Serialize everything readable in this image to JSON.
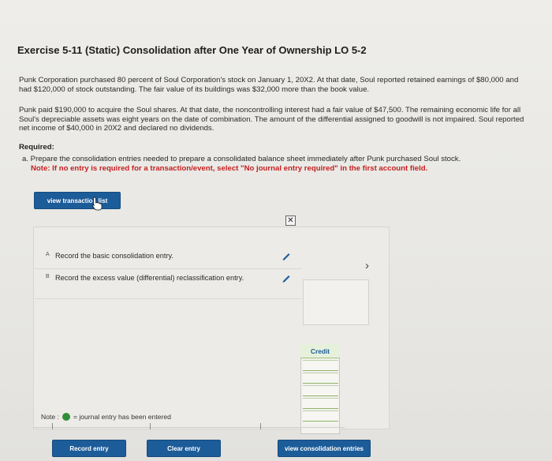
{
  "exercise": {
    "title": "Exercise 5-11 (Static) Consolidation after One Year of Ownership LO 5-2",
    "paragraph1": "Punk Corporation purchased 80 percent of Soul Corporation's stock on January 1, 20X2. At that date, Soul reported retained earnings of $80,000 and had $120,000 of stock outstanding. The fair value of its buildings was $32,000 more than the book value.",
    "paragraph2": "Punk paid $190,000 to acquire the Soul shares. At that date, the noncontrolling interest had a fair value of $47,500. The remaining economic life for all Soul's depreciable assets was eight years on the date of combination. The amount of the differential assigned to goodwill is not impaired. Soul reported net income of $40,000 in 20X2 and declared no dividends.",
    "required_label": "Required:",
    "requirement_a": "a. Prepare the consolidation entries needed to prepare a consolidated balance sheet immediately after Punk purchased Soul stock.",
    "note_red": "Note: If no entry is required for a transaction/event, select \"No journal entry required\" in the first account field."
  },
  "buttons": {
    "view_transaction_list": "view transaction list",
    "record_entry": "Record entry",
    "clear_entry": "Clear entry",
    "view_consolidation_entries": "view consolidation entries"
  },
  "transactions": [
    {
      "letter": "A",
      "text": "Record the basic consolidation entry."
    },
    {
      "letter": "B",
      "text": "Record the excess value (differential) reclassification entry."
    }
  ],
  "journal": {
    "credit_header": "Credit"
  },
  "legend": {
    "note_label": "Note :",
    "note_text": "= journal entry has been entered"
  },
  "colors": {
    "button_blue": "#1c5c99",
    "note_red": "#c31f1f",
    "entered_green": "#2f8f36"
  }
}
